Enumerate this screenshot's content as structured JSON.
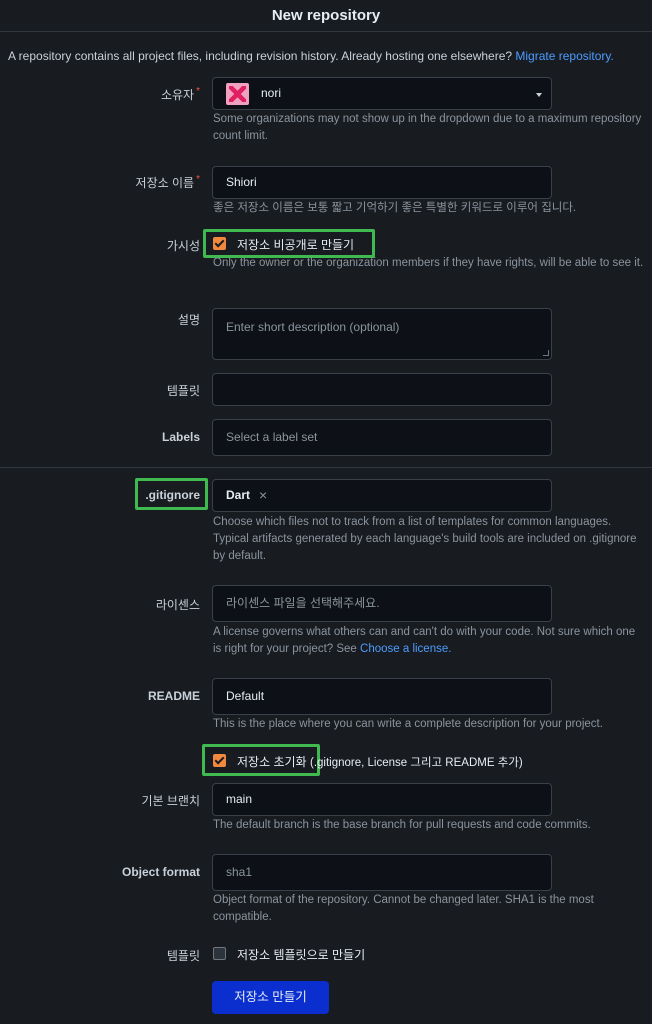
{
  "header": {
    "title": "New repository"
  },
  "intro": {
    "text": "A repository contains all project files, including revision history. Already hosting one elsewhere? ",
    "link": "Migrate repository."
  },
  "owner": {
    "label": "소유자",
    "required": "*",
    "value": "nori",
    "help": "Some organizations may not show up in the dropdown due to a maximum repository count limit."
  },
  "repo_name": {
    "label": "저장소 이름",
    "required": "*",
    "value": "Shiori",
    "help": "좋은 저장소 이름은 보통 짧고 기억하기 좋은 특별한 키워드로 이루어 집니다."
  },
  "visibility": {
    "label": "가시성",
    "checkbox_label": "저장소 비공개로 만들기",
    "checked": true,
    "help": "Only the owner or the organization members if they have rights, will be able to see it."
  },
  "description": {
    "label": "설명",
    "placeholder": "Enter short description (optional)"
  },
  "template": {
    "label": "템플릿",
    "value": ""
  },
  "labels": {
    "label": "Labels",
    "placeholder": "Select a label set"
  },
  "gitignore": {
    "label": ".gitignore",
    "value": "Dart",
    "clear": "×",
    "help": "Choose which files not to track from a list of templates for common languages. Typical artifacts generated by each language's build tools are included on .gitignore by default."
  },
  "license": {
    "label": "라이센스",
    "placeholder": "라이센스 파일을 선택해주세요.",
    "help": "A license governs what others can and can't do with your code. Not sure which one is right for your project? See ",
    "help_link": "Choose a license."
  },
  "readme": {
    "label": "README",
    "value": "Default",
    "help": "This is the place where you can write a complete description for your project."
  },
  "init": {
    "checkbox_label": "저장소 초기화",
    "suffix": "(.gitignore, License 그리고 README 추가)",
    "checked": true
  },
  "default_branch": {
    "label": "기본 브랜치",
    "value": "main",
    "help": "The default branch is the base branch for pull requests and code commits."
  },
  "object_format": {
    "label": "Object format",
    "value": "sha1",
    "help": "Object format of the repository. Cannot be changed later. SHA1 is the most compatible."
  },
  "template_repo": {
    "label": "템플릿",
    "checkbox_label": "저장소 템플릿으로 만들기",
    "checked": false
  },
  "submit": {
    "label": "저장소 만들기"
  },
  "colors": {
    "accent": "#4c9dff",
    "checkbox": "#f0883e",
    "highlight": "#3fb950",
    "button": "#0b2fcf",
    "required": "#f85149"
  }
}
